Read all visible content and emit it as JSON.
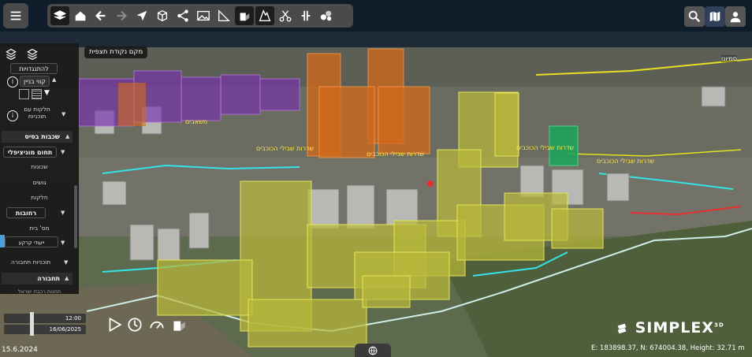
{
  "toolbar": {
    "icons": [
      "layers-icon",
      "home-icon",
      "back-arrow-icon",
      "forward-arrow-icon",
      "cursor-icon",
      "cube-icon",
      "share-icon",
      "image-icon",
      "angle-measure-icon",
      "shadow-study-icon",
      "terrain-icon",
      "scissors-icon",
      "split-icon",
      "globe-icon"
    ]
  },
  "right_buttons": {
    "icons": [
      "search-icon",
      "map-icon",
      "user-icon"
    ]
  },
  "viewpoint_label": "מקם נקודת תצפית",
  "panel": {
    "top_icons": [
      "layers-stack-icon",
      "layers-alt-icon"
    ],
    "planning_button": "להתנגדויות",
    "building_lines_label": "קווי בניין",
    "parcels_with_plans_label": "חלקות עם תוכניות",
    "base_layers_header": "שכבות בסיס",
    "municipal_area_label": "תחום מוניציפלי",
    "items": [
      "שכונות",
      "גושים",
      "חלקות"
    ],
    "streets_label": "רחובות",
    "house_number_label": "מס' בית",
    "traffic_uses_label": "ייעודי קרקע",
    "transport_plans_label": "תוכניות תחבורה",
    "transport_header": "תחבורה",
    "cut_text": "תחנות רכבת ישראל"
  },
  "map_labels": [
    "שדרות שבילי הכוכבים",
    "שדרות שבילי הכוכבים",
    "שדרות שבילי הכוכבים",
    "שדרות שבילי הכוכבים",
    "משאבים"
  ],
  "top_right_label": "סמיונו",
  "timeline": {
    "time": "12:00",
    "date": "16/06/2025"
  },
  "controls": [
    "play-icon",
    "clock-icon",
    "speedometer-icon",
    "cube-shadow-icon"
  ],
  "logo": "SIMPLEX",
  "logo_sup": "3D",
  "coordinates": "E: 183898.37, N: 674004.38, Height: 32.71 m",
  "imagery_date": "15.6.2024",
  "colors": {
    "toolbar_bg": "#4a4a4a",
    "panel_bg": "#1a1a1a",
    "building_yellow": "#b9b83a",
    "building_orange": "#d46a1a",
    "building_purple": "#7a2fb0",
    "building_green": "#1fa35a",
    "road_cyan": "#35e3e6",
    "road_red": "#e63030"
  }
}
